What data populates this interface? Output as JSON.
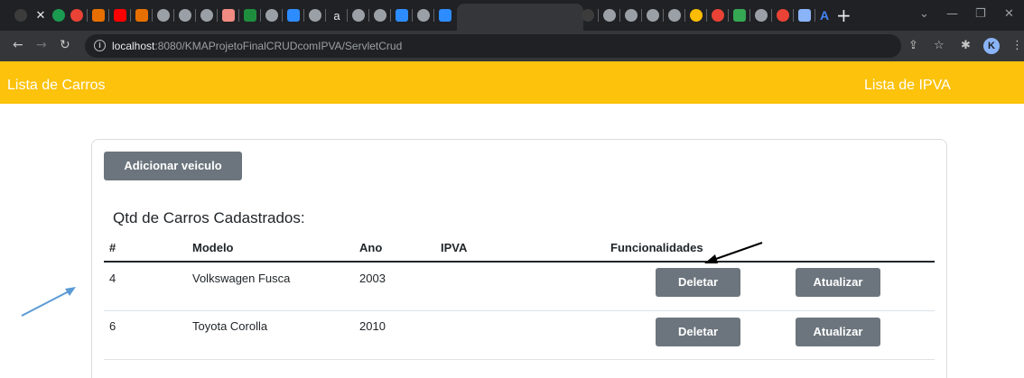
{
  "browser": {
    "url_host": "localhost",
    "url_rest": ":8080/KMAProjetoFinalCRUDcomIPVA/ServletCrud",
    "profile_initial": "K",
    "new_tab_symbol": "+",
    "colors": {
      "chrome_dark": "#202124",
      "toolbar": "#35363a"
    }
  },
  "navbar": {
    "left_link": "Lista de Carros",
    "right_link": "Lista de IPVA",
    "color": "#fcc20c"
  },
  "main": {
    "add_button": "Adicionar veiculo",
    "count_label": "Qtd de Carros Cadastrados:",
    "table": {
      "headers": [
        "#",
        "Modelo",
        "Ano",
        "IPVA",
        "Funcionalidades"
      ],
      "rows": [
        {
          "id": "4",
          "modelo": "Volkswagen Fusca",
          "ano": "2003",
          "ipva": "",
          "delete": "Deletar",
          "update": "Atualizar"
        },
        {
          "id": "6",
          "modelo": "Toyota Corolla",
          "ano": "2010",
          "ipva": "",
          "delete": "Deletar",
          "update": "Atualizar"
        }
      ]
    },
    "button_color": "#6c757d"
  },
  "annotations": {
    "arrow_colors": [
      "#5b9bd5",
      "#000000"
    ]
  }
}
